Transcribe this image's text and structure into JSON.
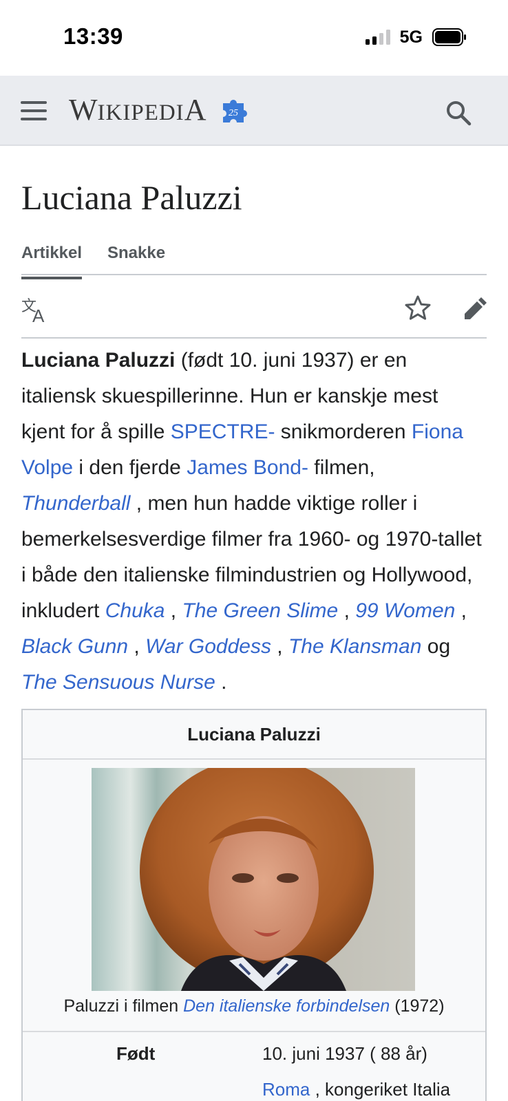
{
  "status": {
    "time": "13:39",
    "network": "5G"
  },
  "header": {
    "wordmark_big_1": "W",
    "wordmark_small_1": "IKIPEDI",
    "wordmark_big_2": "A",
    "puzzle_badge": "25"
  },
  "page": {
    "title": "Luciana Paluzzi",
    "tabs": [
      "Artikkel",
      "Snakke"
    ]
  },
  "lead": {
    "subject": "Luciana Paluzzi",
    "t1": " (født 10. juni 1937) er en italiensk skuespillerinne. Hun er kanskje mest kjent for å spille ",
    "l_spectre": "SPECTRE-",
    "t2": " snikmorderen ",
    "l_fiona": "Fiona Volpe",
    "t3": " i den fjerde ",
    "l_bond": "James Bond-",
    "t4": " filmen, ",
    "l_thunderball": "Thunderball",
    "t5": " , men hun hadde viktige roller i bemerkelsesverdige filmer fra 1960- og 1970-tallet i både den italienske filmindustrien og Hollywood, inkludert ",
    "l_chuka": "Chuka",
    "sep1": " , ",
    "l_slime": "The Green Slime",
    "sep2": " , ",
    "l_99women": "99 Women",
    "sep3": " , ",
    "l_blackgunn": "Black Gunn",
    "sep4": " , ",
    "l_wargoddess": "War Goddess",
    "sep5": " , ",
    "l_klansman": "The Klansman",
    "t6": " og ",
    "l_nurse": "The Sensuous Nurse",
    "t7": " ."
  },
  "infobox": {
    "title": "Luciana Paluzzi",
    "caption_pre": "Paluzzi i filmen ",
    "caption_link": "Den italienske forbindelsen",
    "caption_post": " (1972)",
    "born_label": "Født",
    "born_value": "10. juni 1937 (  88 år)",
    "born_place_link": "Roma",
    "born_place_rest": " , kongeriket Italia"
  },
  "colors": {
    "link": "#3366cc",
    "header_bg": "#eaecf0",
    "text": "#202122",
    "puzzle": "#3b7bd8"
  }
}
